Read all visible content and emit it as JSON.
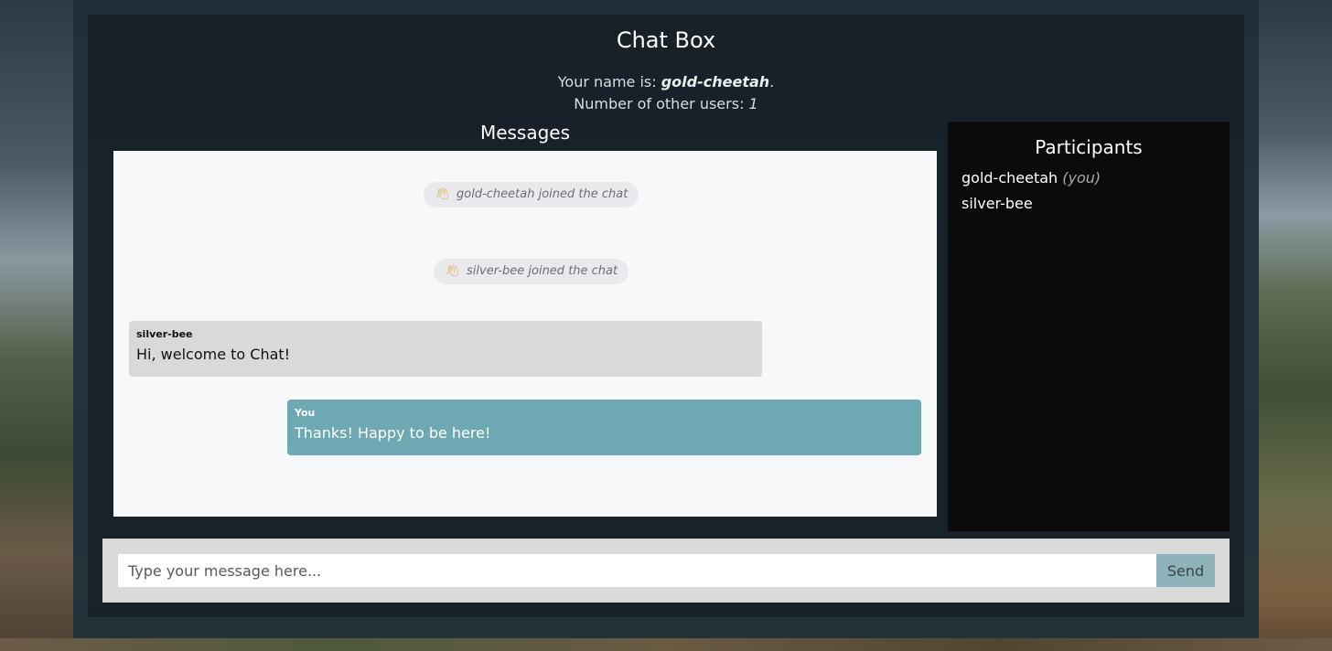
{
  "header": {
    "title": "Chat Box",
    "name_prefix": "Your name is: ",
    "username": "gold-cheetah",
    "name_suffix": ".",
    "others_prefix": "Number of other users: ",
    "others_count": "1"
  },
  "messages": {
    "heading": "Messages",
    "system": [
      {
        "icon": "waving-hand-icon",
        "text": "gold-cheetah joined the chat"
      },
      {
        "icon": "waving-hand-icon",
        "text": "silver-bee joined the chat"
      }
    ],
    "chat": [
      {
        "author": "silver-bee",
        "text": "Hi, welcome to Chat!"
      },
      {
        "author": "You",
        "text": "Thanks! Happy to be here!"
      }
    ]
  },
  "participants": {
    "heading": "Participants",
    "items": [
      {
        "name": "gold-cheetah",
        "tag": "(you)"
      },
      {
        "name": "silver-bee",
        "tag": ""
      }
    ]
  },
  "composer": {
    "placeholder": "Type your message here...",
    "value": "",
    "send_label": "Send"
  },
  "colors": {
    "my_bubble": "#6ea8b3",
    "other_bubble": "#d9d9d9",
    "send_button": "#8db2ba",
    "participants_bg": "#0b0b0b"
  }
}
